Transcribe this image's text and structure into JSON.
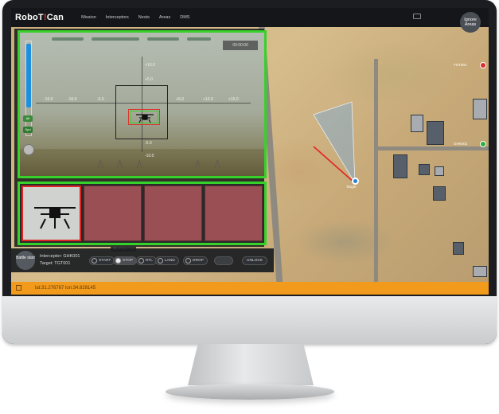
{
  "app": {
    "logo_text": "RoboT",
    "logo_sep": "!",
    "logo_text2": "Can"
  },
  "topbar": {
    "nav": [
      "Mission",
      "Interceptors",
      "Nests",
      "Areas",
      "DMS"
    ],
    "ignore_btn": "Ignore Areas"
  },
  "video": {
    "rec_label": "00:00:00",
    "ticks": [
      "-15.0",
      "-10.0",
      "-5.0",
      "+5.0",
      "+10.0",
      "+15.0"
    ],
    "vticks": [
      "+5.0",
      "+10.0",
      "-5.0",
      "-10.0"
    ],
    "alt_indicator": "Alt",
    "speed_indicator": "Spd",
    "thumb_label": "Start Intercept"
  },
  "map": {
    "target_label": "Target",
    "side_labels": [
      "TGT001",
      "GHK001"
    ]
  },
  "controls": {
    "battle_btn": "Battle start",
    "interceptor_label": "Interceptor: GHK001",
    "target_label": "Target: TGT001",
    "buttons": [
      {
        "label": "START",
        "icon": "play-icon"
      },
      {
        "label": "STOP",
        "icon": "stop-icon"
      },
      {
        "label": "RTL",
        "icon": "return-icon"
      },
      {
        "label": "LAND",
        "icon": "land-icon"
      },
      {
        "label": "DROP",
        "icon": "drop-icon"
      }
    ],
    "unlock": "UNLOCK"
  },
  "status": {
    "coords": "lat:31.276767 lon:34.828145"
  },
  "colors": {
    "accent_green": "#37d12b",
    "status_orange": "#f19a1c",
    "target_red": "#e02424"
  }
}
